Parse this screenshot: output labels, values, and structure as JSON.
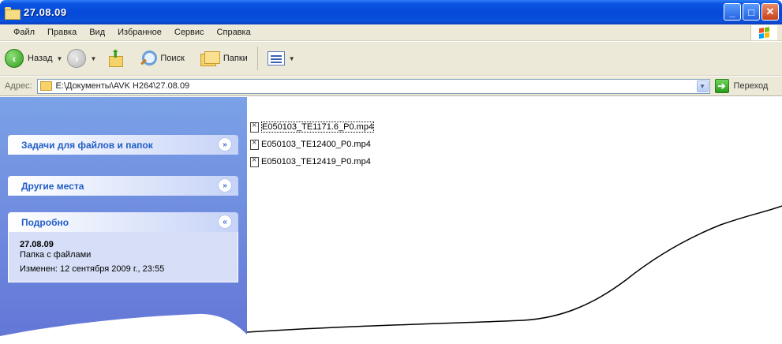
{
  "window": {
    "title": "27.08.09",
    "buttons": {
      "minimize": "_",
      "maximize": "□",
      "close": "✕"
    }
  },
  "menu": [
    "Файл",
    "Правка",
    "Вид",
    "Избранное",
    "Сервис",
    "Справка"
  ],
  "toolbar": {
    "back_label": "Назад",
    "search_label": "Поиск",
    "folders_label": "Папки"
  },
  "address": {
    "label": "Адрес:",
    "value": "E:\\Документы\\AVK H264\\27.08.09",
    "go_label": "Переход"
  },
  "taskpane": {
    "tasks_title": "Задачи для файлов и папок",
    "other_title": "Другие места",
    "details_title": "Подробно",
    "details_name": "27.08.09",
    "details_type": "Папка с файлами",
    "details_modified": "Изменен: 12 сентября 2009 г., 23:55"
  },
  "files": [
    "E050103_TE1171.6_P0.mp4",
    "E050103_TE12400_P0.mp4",
    "E050103_TE12419_P0.mp4"
  ]
}
